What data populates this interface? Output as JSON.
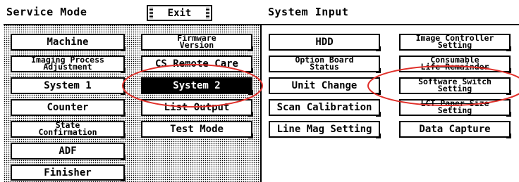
{
  "header": {
    "mode_title": "Service Mode",
    "exit_label": "Exit",
    "section_title": "System Input"
  },
  "col1": {
    "machine": "Machine",
    "imaging_1": "Imaging Process",
    "imaging_2": "Adjustment",
    "system1": "System 1",
    "counter": "Counter",
    "state_1": "State",
    "state_2": "Confirmation",
    "adf": "ADF",
    "finisher": "Finisher"
  },
  "col2": {
    "firmware_1": "Firmware",
    "firmware_2": "Version",
    "cs_remote": "CS Remote Care",
    "system2": "System 2",
    "list_output": "List Output",
    "test_mode": "Test Mode"
  },
  "col3": {
    "hdd": "HDD",
    "option_1": "Option Board",
    "option_2": "Status",
    "unit_change": "Unit Change",
    "scan_cal": "Scan Calibration",
    "line_mag": "Line Mag Setting"
  },
  "col4": {
    "image_ctrl_1": "Image Controller",
    "image_ctrl_2": "Setting",
    "consumable_1": "Consumable",
    "consumable_2": "Life Remainder",
    "software_1": "Software Switch",
    "software_2": "Setting",
    "lct_1": "LCT Paper Size",
    "lct_2": "Setting",
    "data_capture": "Data Capture"
  },
  "colors": {
    "annotation": "#e0302a",
    "selected_bg": "#000000"
  }
}
